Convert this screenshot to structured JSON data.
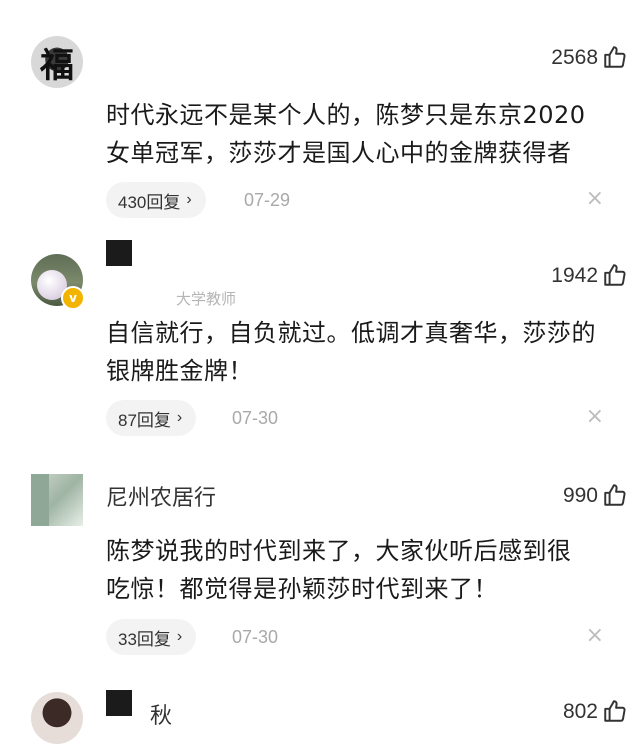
{
  "comments": [
    {
      "avatar_glyph": "福",
      "name": "",
      "subtitle": "",
      "likes": "2568",
      "text_lines": [
        "时代永远不是某个人的，陈梦只是东京2020",
        "女单冠军，莎莎才是国人心中的金牌获得者"
      ],
      "replies": "430回复",
      "date": "07-29"
    },
    {
      "avatar_glyph": "",
      "name": "",
      "subtitle": "大学教师",
      "likes": "1942",
      "text_lines": [
        "自信就行，自负就过。低调才真奢华，莎莎的",
        "银牌胜金牌！"
      ],
      "replies": "87回复",
      "date": "07-30"
    },
    {
      "avatar_glyph": "",
      "name": "尼州农居行",
      "subtitle": "",
      "likes": "990",
      "text_lines": [
        "陈梦说我的时代到来了，大家伙听后感到很",
        "吃惊！都觉得是孙颖莎时代到来了！"
      ],
      "replies": "33回复",
      "date": "07-30"
    },
    {
      "avatar_glyph": "",
      "name": "秋",
      "subtitle": "",
      "likes": "802",
      "text_lines": [],
      "replies": "",
      "date": ""
    }
  ],
  "icons": {
    "like": "thumbs-up-icon",
    "close": "close-icon",
    "chevron": "chevron-right-icon",
    "verified": "verified-badge-icon"
  },
  "glyphs": {
    "chevron": "›",
    "close": "×",
    "verified": "v"
  },
  "colors": {
    "badge": "#f3b400",
    "muted": "#a9a9a9",
    "pill": "#f3f3f3"
  }
}
